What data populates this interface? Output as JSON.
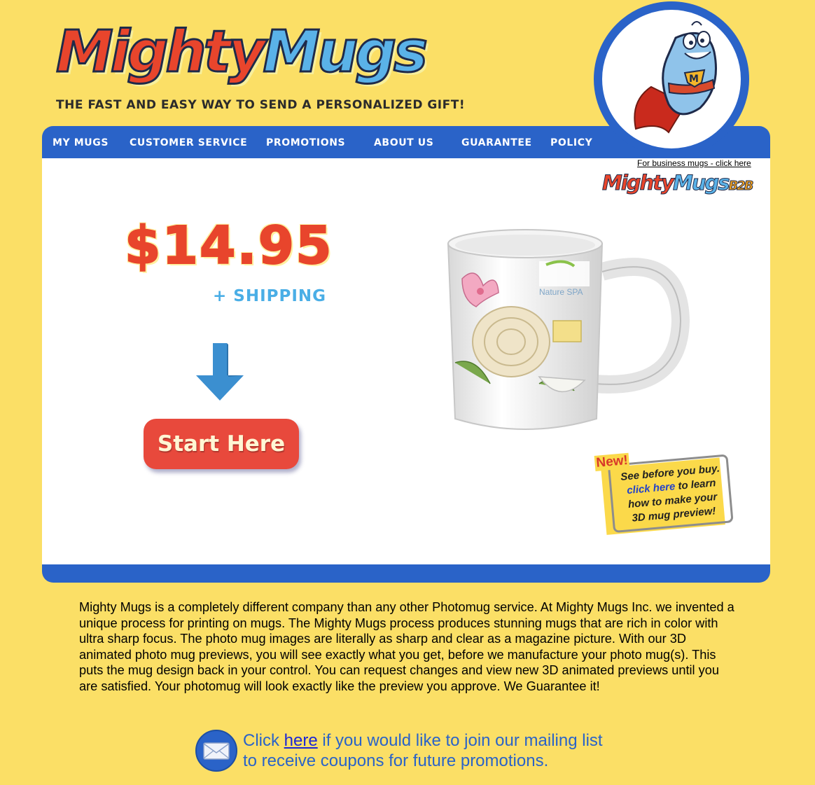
{
  "header": {
    "logo_word1": "Mighty",
    "logo_word2": "Mugs",
    "tagline": "THE FAST AND EASY WAY TO SEND A  PERSONALIZED GIFT!"
  },
  "nav": {
    "items": [
      {
        "label": "MY MUGS"
      },
      {
        "label": "CUSTOMER SERVICE"
      },
      {
        "label": "PROMOTIONS"
      },
      {
        "label": "ABOUT US"
      },
      {
        "label": "GUARANTEE"
      },
      {
        "label": "POLICY"
      }
    ]
  },
  "business": {
    "link_text": "For business mugs - click here",
    "logo_word1": "Mighty",
    "logo_word2": "Mugs",
    "logo_suffix": "B2B"
  },
  "promo": {
    "price": "$14.95",
    "shipping": "+ SHIPPING",
    "start_button": "Start Here"
  },
  "mug": {
    "brand": "Nature SPA"
  },
  "note": {
    "new_label": "New!",
    "line1": "See before you buy.",
    "link_text": "click here",
    "line2_rest": " to learn",
    "line3": "how to make your",
    "line4": "3D mug preview!"
  },
  "description": "Mighty Mugs is a completely different company than any other Photomug service. At Mighty Mugs Inc. we invented a unique process for printing on mugs. The Mighty Mugs process produces stunning mugs that are rich in color with ultra sharp focus. The photo mug images are literally as sharp and clear as a magazine picture. With our 3D animated photo mug previews, you will see exactly what you get, before we manufacture your photo mug(s). This puts the mug design back in your control. You can request changes and view new 3D animated previews until you are satisfied. Your photomug will look exactly like the preview you approve. We Guarantee it!",
  "mailing": {
    "prefix": "Click ",
    "link_text": "here",
    "suffix": " if you would like to join our mailing list",
    "line2": "to receive coupons for future promotions."
  },
  "colors": {
    "background": "#fbdf66",
    "nav_blue": "#2a63c8",
    "logo_red": "#e8452c",
    "logo_blue": "#5ab2e8",
    "button_red": "#e8493c"
  },
  "icons": [
    "mascot-icon",
    "down-arrow-icon",
    "mail-icon"
  ]
}
